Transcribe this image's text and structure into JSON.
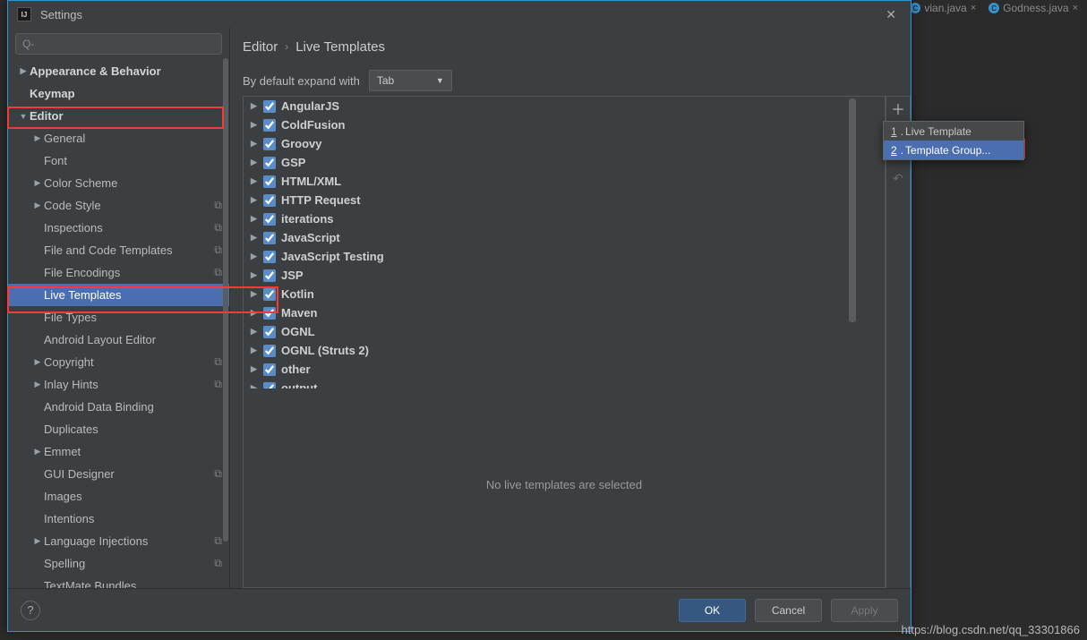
{
  "bg_tabs": [
    {
      "label": "vian.java",
      "close": true
    },
    {
      "label": "Godness.java",
      "close": true
    }
  ],
  "window": {
    "title": "Settings"
  },
  "breadcrumb": {
    "section": "Editor",
    "page": "Live Templates"
  },
  "expand": {
    "label": "By default expand with",
    "value": "Tab"
  },
  "sidebar": {
    "items": [
      {
        "label": "Appearance & Behavior",
        "pad": 0,
        "arrow": "right",
        "emph": true
      },
      {
        "label": "Keymap",
        "pad": 0,
        "arrow": "",
        "emph": true
      },
      {
        "label": "Editor",
        "pad": 0,
        "arrow": "down",
        "emph": true
      },
      {
        "label": "General",
        "pad": 1,
        "arrow": "right"
      },
      {
        "label": "Font",
        "pad": 1,
        "arrow": ""
      },
      {
        "label": "Color Scheme",
        "pad": 1,
        "arrow": "right"
      },
      {
        "label": "Code Style",
        "pad": 1,
        "arrow": "right",
        "copy": true
      },
      {
        "label": "Inspections",
        "pad": 1,
        "arrow": "",
        "copy": true
      },
      {
        "label": "File and Code Templates",
        "pad": 1,
        "arrow": "",
        "copy": true
      },
      {
        "label": "File Encodings",
        "pad": 1,
        "arrow": "",
        "copy": true
      },
      {
        "label": "Live Templates",
        "pad": 1,
        "arrow": "",
        "selected": true
      },
      {
        "label": "File Types",
        "pad": 1,
        "arrow": ""
      },
      {
        "label": "Android Layout Editor",
        "pad": 1,
        "arrow": ""
      },
      {
        "label": "Copyright",
        "pad": 1,
        "arrow": "right",
        "copy": true
      },
      {
        "label": "Inlay Hints",
        "pad": 1,
        "arrow": "right",
        "copy": true
      },
      {
        "label": "Android Data Binding",
        "pad": 1,
        "arrow": ""
      },
      {
        "label": "Duplicates",
        "pad": 1,
        "arrow": ""
      },
      {
        "label": "Emmet",
        "pad": 1,
        "arrow": "right"
      },
      {
        "label": "GUI Designer",
        "pad": 1,
        "arrow": "",
        "copy": true
      },
      {
        "label": "Images",
        "pad": 1,
        "arrow": ""
      },
      {
        "label": "Intentions",
        "pad": 1,
        "arrow": ""
      },
      {
        "label": "Language Injections",
        "pad": 1,
        "arrow": "right",
        "copy": true
      },
      {
        "label": "Spelling",
        "pad": 1,
        "arrow": "",
        "copy": true
      },
      {
        "label": "TextMate Bundles",
        "pad": 1,
        "arrow": ""
      }
    ]
  },
  "templates": {
    "groups": [
      "AngularJS",
      "ColdFusion",
      "Groovy",
      "GSP",
      "HTML/XML",
      "HTTP Request",
      "iterations",
      "JavaScript",
      "JavaScript Testing",
      "JSP",
      "Kotlin",
      "Maven",
      "OGNL",
      "OGNL (Struts 2)",
      "other",
      "output"
    ]
  },
  "detail": {
    "empty_msg": "No live templates are selected"
  },
  "popup": {
    "items": [
      {
        "num": "1",
        "label": "Live Template"
      },
      {
        "num": "2",
        "label": "Template Group...",
        "selected": true
      }
    ]
  },
  "footer": {
    "ok": "OK",
    "cancel": "Cancel",
    "apply": "Apply",
    "help": "?"
  },
  "watermark": "https://blog.csdn.net/qq_33301866"
}
